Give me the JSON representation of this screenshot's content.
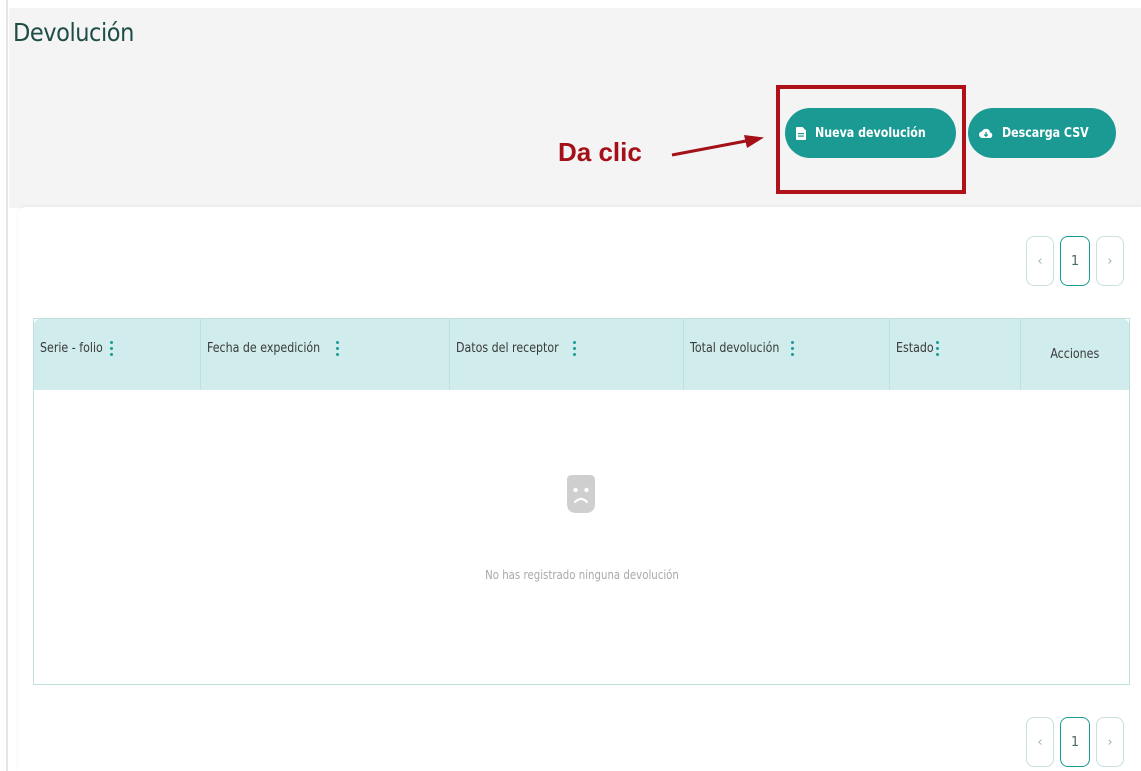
{
  "page": {
    "title": "Devolución"
  },
  "toolbar": {
    "new_label": "Nueva devolución",
    "csv_label": "Descarga CSV"
  },
  "annotation": {
    "text": "Da clic",
    "color": "#a41018"
  },
  "pagination": {
    "prev": "‹",
    "current": "1",
    "next": "›"
  },
  "table": {
    "columns": [
      {
        "label": "Serie - folio",
        "sortable": true
      },
      {
        "label": "Fecha de expedición",
        "sortable": true
      },
      {
        "label": "Datos del receptor",
        "sortable": true
      },
      {
        "label": "Total devolución",
        "sortable": true
      },
      {
        "label": "Estado",
        "sortable": true
      },
      {
        "label": "Acciones",
        "sortable": false
      }
    ],
    "empty_message": "No has registrado ninguna devolución"
  },
  "colors": {
    "accent": "#1b9a93",
    "header_bg": "#d0ecec",
    "title": "#1e4d47",
    "annotation": "#b01018"
  },
  "icons": {
    "new_button": "document-icon",
    "csv_button": "cloud-download-icon",
    "empty_state": "sad-face-icon",
    "sort": "kebab-icon"
  }
}
